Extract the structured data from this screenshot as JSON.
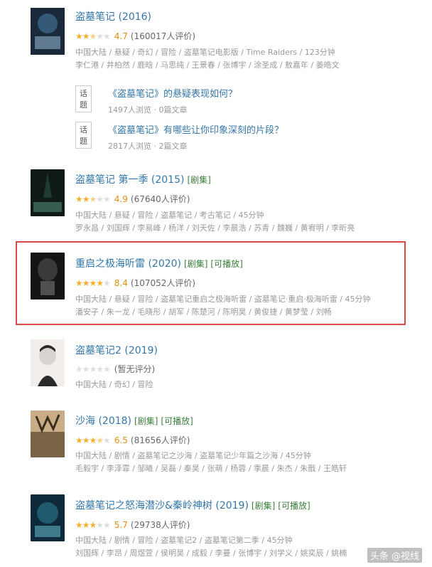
{
  "entries": [
    {
      "title": "盗墓笔记 (2016)",
      "tags": [],
      "score": "4.7",
      "stars": 2.5,
      "count": "(160017人评价)",
      "meta1": "中国大陆 / 悬疑 / 奇幻 / 冒险 / 盗墓笔记电影版 / Time Raiders / 123分钟",
      "meta2": "李仁港 / 井柏然 / 鹿晗 / 马思纯 / 王景春 / 张博宇 / 涂圣成 / 敖嘉年 / 姜皓文",
      "poster_colors": [
        "#1b2a3a",
        "#355a78",
        "#8fb1c8"
      ]
    },
    {
      "title": "盗墓笔记 第一季 (2015)",
      "tags": [
        "[剧集]"
      ],
      "score": "4.9",
      "stars": 2.5,
      "count": "(67640人评价)",
      "meta1": "中国大陆 / 悬疑 / 冒险 / 盗墓笔记 / 考古笔记 / 45分钟",
      "meta2": "罗永昌 / 刘国辉 / 李易峰 / 杨洋 / 刘天佐 / 李晨浩 / 苏青 / 魏巍 / 黄宥明 / 李昕亮",
      "poster_colors": [
        "#0f1a17",
        "#1f3a32",
        "#4f8a76"
      ]
    },
    {
      "title": "重启之极海听雷 (2020)",
      "tags": [
        "[剧集]",
        "[可播放]"
      ],
      "score": "8.4",
      "stars": 4,
      "count": "(107052人评价)",
      "meta1": "中国大陆 / 悬疑 / 冒险 / 盗墓笔记重启之极海听雷 / 盗墓笔记·重启·极海听雷 / 45分钟",
      "meta2": "潘安子 / 朱一龙 / 毛晓彤 / 胡军 / 陈楚河 / 陈明昊 / 黄俊捷 / 黄梦莹 / 刘畅",
      "poster_colors": [
        "#141414",
        "#3a3a3a",
        "#8a8a8a"
      ]
    },
    {
      "title": "盗墓笔记2 (2019)",
      "tags": [],
      "score": "",
      "stars": 0,
      "count": "(暂无评分)",
      "meta1": "中国大陆 / 奇幻 / 冒险",
      "meta2": "",
      "poster_colors": [
        "#2a2a2a",
        "#d9d4cf",
        "#f2eeea"
      ]
    },
    {
      "title": "沙海 (2018)",
      "tags": [
        "[剧集]",
        "[可播放]"
      ],
      "score": "6.5",
      "stars": 3.5,
      "count": "(81656人评价)",
      "meta1": "中国大陆 / 剧情 / 盗墓笔记之沙海 / 盗墓笔记少年篇之沙海 / 45分钟",
      "meta2": "毛毅宇 / 李泽霏 / 邹曦 / 吴磊 / 秦昊 / 张萌 / 杨蓉 / 季晨 / 朱杰 / 朱戬 / 王皓轩",
      "poster_colors": [
        "#3a2c1e",
        "#7a6246",
        "#c8ad86"
      ]
    },
    {
      "title": "盗墓笔记之怒海潜沙&秦岭神树 (2019)",
      "tags": [
        "[剧集]",
        "[可播放]"
      ],
      "score": "5.7",
      "stars": 3,
      "count": "(29738人评价)",
      "meta1": "中国大陆 / 剧情 / 冒险 / 盗墓笔记2 / 盗墓笔记第二季 / 45分钟",
      "meta2": "刘国辉 / 李昂 / 周煜萱 / 侯明昊 / 成毅 / 李曼 / 张博宇 / 刘学义 / 姚奕辰 / 姚楠",
      "poster_colors": [
        "#0e2a3a",
        "#1f5a6e",
        "#5fb0c0"
      ]
    }
  ],
  "topics": [
    {
      "tag": "话题",
      "title": "《盗墓笔记》的悬疑表现如何？",
      "stats": "1497人浏览 · 0篇文章"
    },
    {
      "tag": "话题",
      "title": "《盗墓笔记》有哪些让你印象深刻的片段？",
      "stats": "2817人浏览 · 2篇文章"
    }
  ],
  "watermark": "头条 @视线",
  "colors": {
    "title_link": "#3377aa",
    "tag_green": "#3a7f3a",
    "star": "#f5b031",
    "highlight": "#d84a44"
  }
}
